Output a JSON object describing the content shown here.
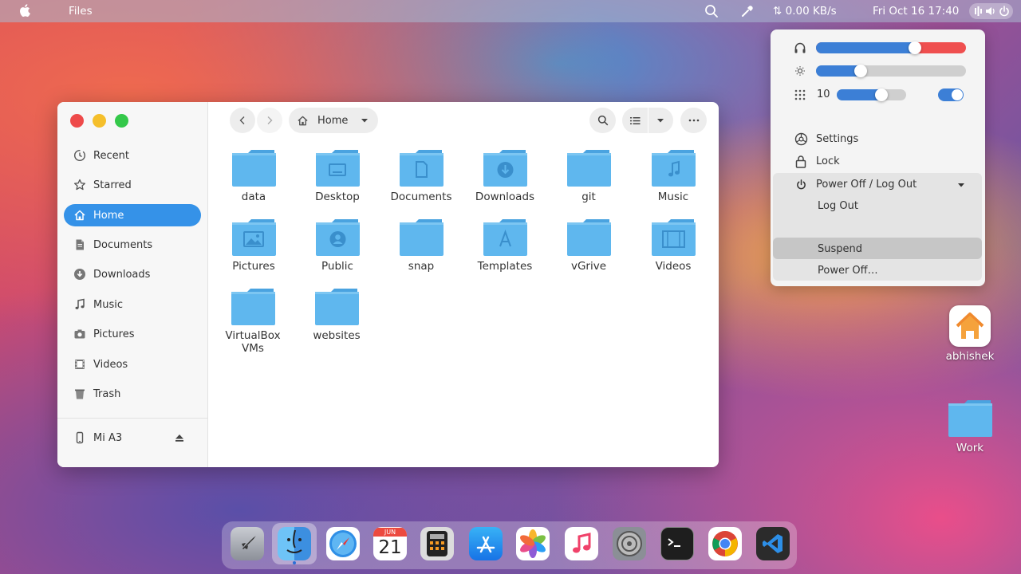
{
  "topbar": {
    "app_name": "Files",
    "network_speed": "⇅ 0.00 KB/s",
    "clock": "Fri Oct 16  17:40"
  },
  "sidebar": {
    "items": [
      {
        "label": "Recent",
        "icon": "clock-icon"
      },
      {
        "label": "Starred",
        "icon": "star-icon"
      },
      {
        "label": "Home",
        "icon": "home-icon",
        "active": true
      },
      {
        "label": "Documents",
        "icon": "document-icon"
      },
      {
        "label": "Downloads",
        "icon": "download-icon"
      },
      {
        "label": "Music",
        "icon": "music-icon"
      },
      {
        "label": "Pictures",
        "icon": "camera-icon"
      },
      {
        "label": "Videos",
        "icon": "film-icon"
      },
      {
        "label": "Trash",
        "icon": "trash-icon"
      }
    ],
    "device": {
      "label": "Mi A3",
      "icon": "phone-icon"
    }
  },
  "toolbar": {
    "location_label": "Home"
  },
  "folders": [
    {
      "label": "data",
      "glyph": ""
    },
    {
      "label": "Desktop",
      "glyph": "desktop"
    },
    {
      "label": "Documents",
      "glyph": "doc"
    },
    {
      "label": "Downloads",
      "glyph": "down"
    },
    {
      "label": "git",
      "glyph": ""
    },
    {
      "label": "Music",
      "glyph": "music"
    },
    {
      "label": "Pictures",
      "glyph": "picture"
    },
    {
      "label": "Public",
      "glyph": "user"
    },
    {
      "label": "snap",
      "glyph": ""
    },
    {
      "label": "Templates",
      "glyph": "templates"
    },
    {
      "label": "vGrive",
      "glyph": ""
    },
    {
      "label": "Videos",
      "glyph": "film"
    },
    {
      "label": "VirtualBox\nVMs",
      "glyph": ""
    },
    {
      "label": "websites",
      "glyph": ""
    }
  ],
  "quick_settings": {
    "volume_level": 0.66,
    "brightness_level": 0.3,
    "workspaces_value": "10",
    "workspaces_level": 0.64,
    "toggle_on": true,
    "settings_label": "Settings",
    "lock_label": "Lock",
    "power_menu_label": "Power Off / Log Out",
    "log_out_label": "Log Out",
    "suspend_label": "Suspend",
    "power_off_label": "Power Off…"
  },
  "desktop": {
    "home_label": "abhishek",
    "work_label": "Work"
  },
  "dock": {
    "apps": [
      "launchpad-icon",
      "finder-icon",
      "safari-icon",
      "calendar-icon",
      "calculator-icon",
      "app-store-icon",
      "photos-icon",
      "music-app-icon",
      "system-settings-icon",
      "terminal-icon",
      "chrome-icon",
      "vscode-icon"
    ],
    "calendar_month": "JUN",
    "calendar_day": "21"
  },
  "colors": {
    "accent": "#3592e8",
    "folder": "#5fb7ee",
    "close": "#ee4a4a",
    "minimize": "#f5bf2b",
    "maximize": "#34c84a"
  }
}
